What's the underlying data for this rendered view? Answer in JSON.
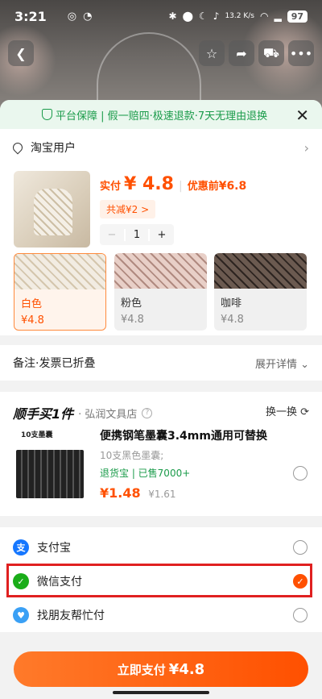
{
  "status_bar": {
    "time": "3:21",
    "net_speed": "13.2 K/s",
    "battery": "97"
  },
  "guarantee": {
    "text": "平台保障 | 假一赔四·极速退款·7天无理由退换"
  },
  "address": {
    "name": "淘宝用户"
  },
  "product": {
    "pay_label": "实付",
    "price": "¥ 4.8",
    "original_label": "优惠前",
    "original_price": "¥6.8",
    "discount": "共减¥2 >",
    "quantity": "1",
    "minus": "−",
    "plus": "+"
  },
  "variants": [
    {
      "name": "白色",
      "price": "¥4.8"
    },
    {
      "name": "粉色",
      "price": "¥4.8"
    },
    {
      "name": "咖啡",
      "price": "¥4.8"
    }
  ],
  "remark": {
    "label": "备注·发票已折叠",
    "expand": "展开详情"
  },
  "addon": {
    "brand": "顺手买1件",
    "store": "· 弘润文具店",
    "swap": "换一换",
    "image_label": "10支墨囊",
    "title": "便携钢笔墨囊3.4mm通用可替换",
    "subtitle": "10支黑色墨囊;",
    "tags": "退货宝 | 已售7000+",
    "price": "¥1.48",
    "original_price": "¥1.61"
  },
  "payment": [
    {
      "name": "支付宝",
      "selected": false
    },
    {
      "name": "微信支付",
      "selected": true
    },
    {
      "name": "找朋友帮忙付",
      "selected": false
    }
  ],
  "submit": {
    "label": "立即支付",
    "amount": "¥4.8"
  },
  "colors": {
    "accent": "#ff5000",
    "green": "#1a9b4a",
    "highlight": "#e02020"
  }
}
